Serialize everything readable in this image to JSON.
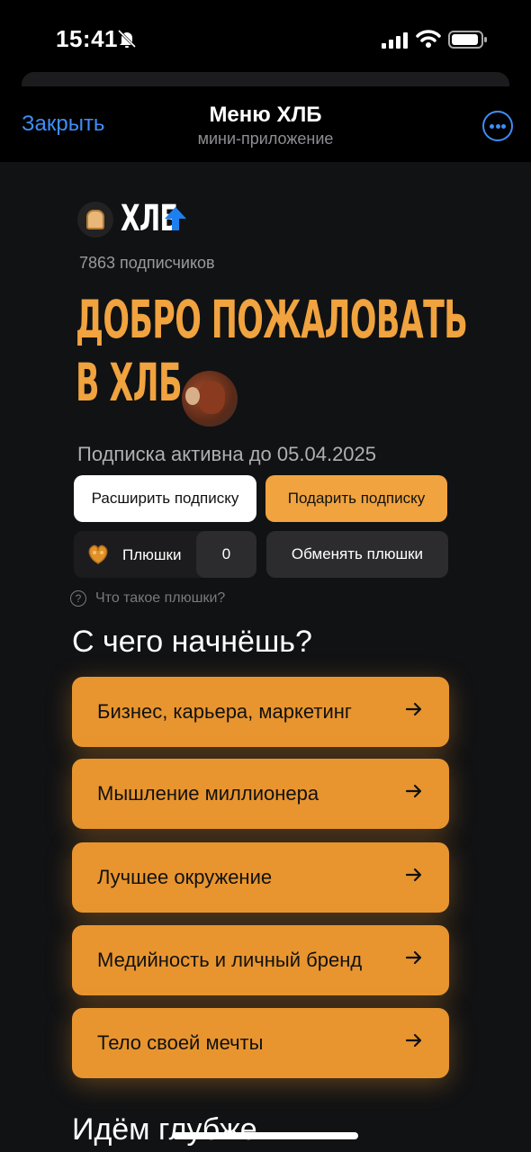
{
  "status": {
    "time": "15:41"
  },
  "header": {
    "close_label": "Закрыть",
    "title": "Меню ХЛБ",
    "subtitle": "мини-приложение"
  },
  "channel": {
    "name": "ХЛБ",
    "subscribers": "7863 подписчиков"
  },
  "welcome": {
    "line1": "ДОБРО ПОЖАЛОВАТЬ",
    "line2": "В ХЛБ"
  },
  "subscription": {
    "status": "Подписка активна до 05.04.2025",
    "extend_label": "Расширить подписку",
    "gift_label": "Подарить подписку"
  },
  "pluski": {
    "label": "Плюшки",
    "count": "0",
    "exchange_label": "Обменять плюшки",
    "help_icon": "?",
    "help_text": "Что такое плюшки?"
  },
  "start": {
    "title": "С чего начнёшь?",
    "topics": [
      {
        "label": "Бизнес, карьера, маркетинг"
      },
      {
        "label": "Мышление миллионера"
      },
      {
        "label": "Лучшее окружение"
      },
      {
        "label": "Медийность и личный бренд"
      },
      {
        "label": "Тело своей мечты"
      }
    ]
  },
  "deeper": {
    "title": "Идём глубже"
  },
  "colors": {
    "accent_orange": "#f0a33e",
    "button_orange": "#e8952f",
    "link_blue": "#3e8ef7",
    "background": "#111214"
  }
}
